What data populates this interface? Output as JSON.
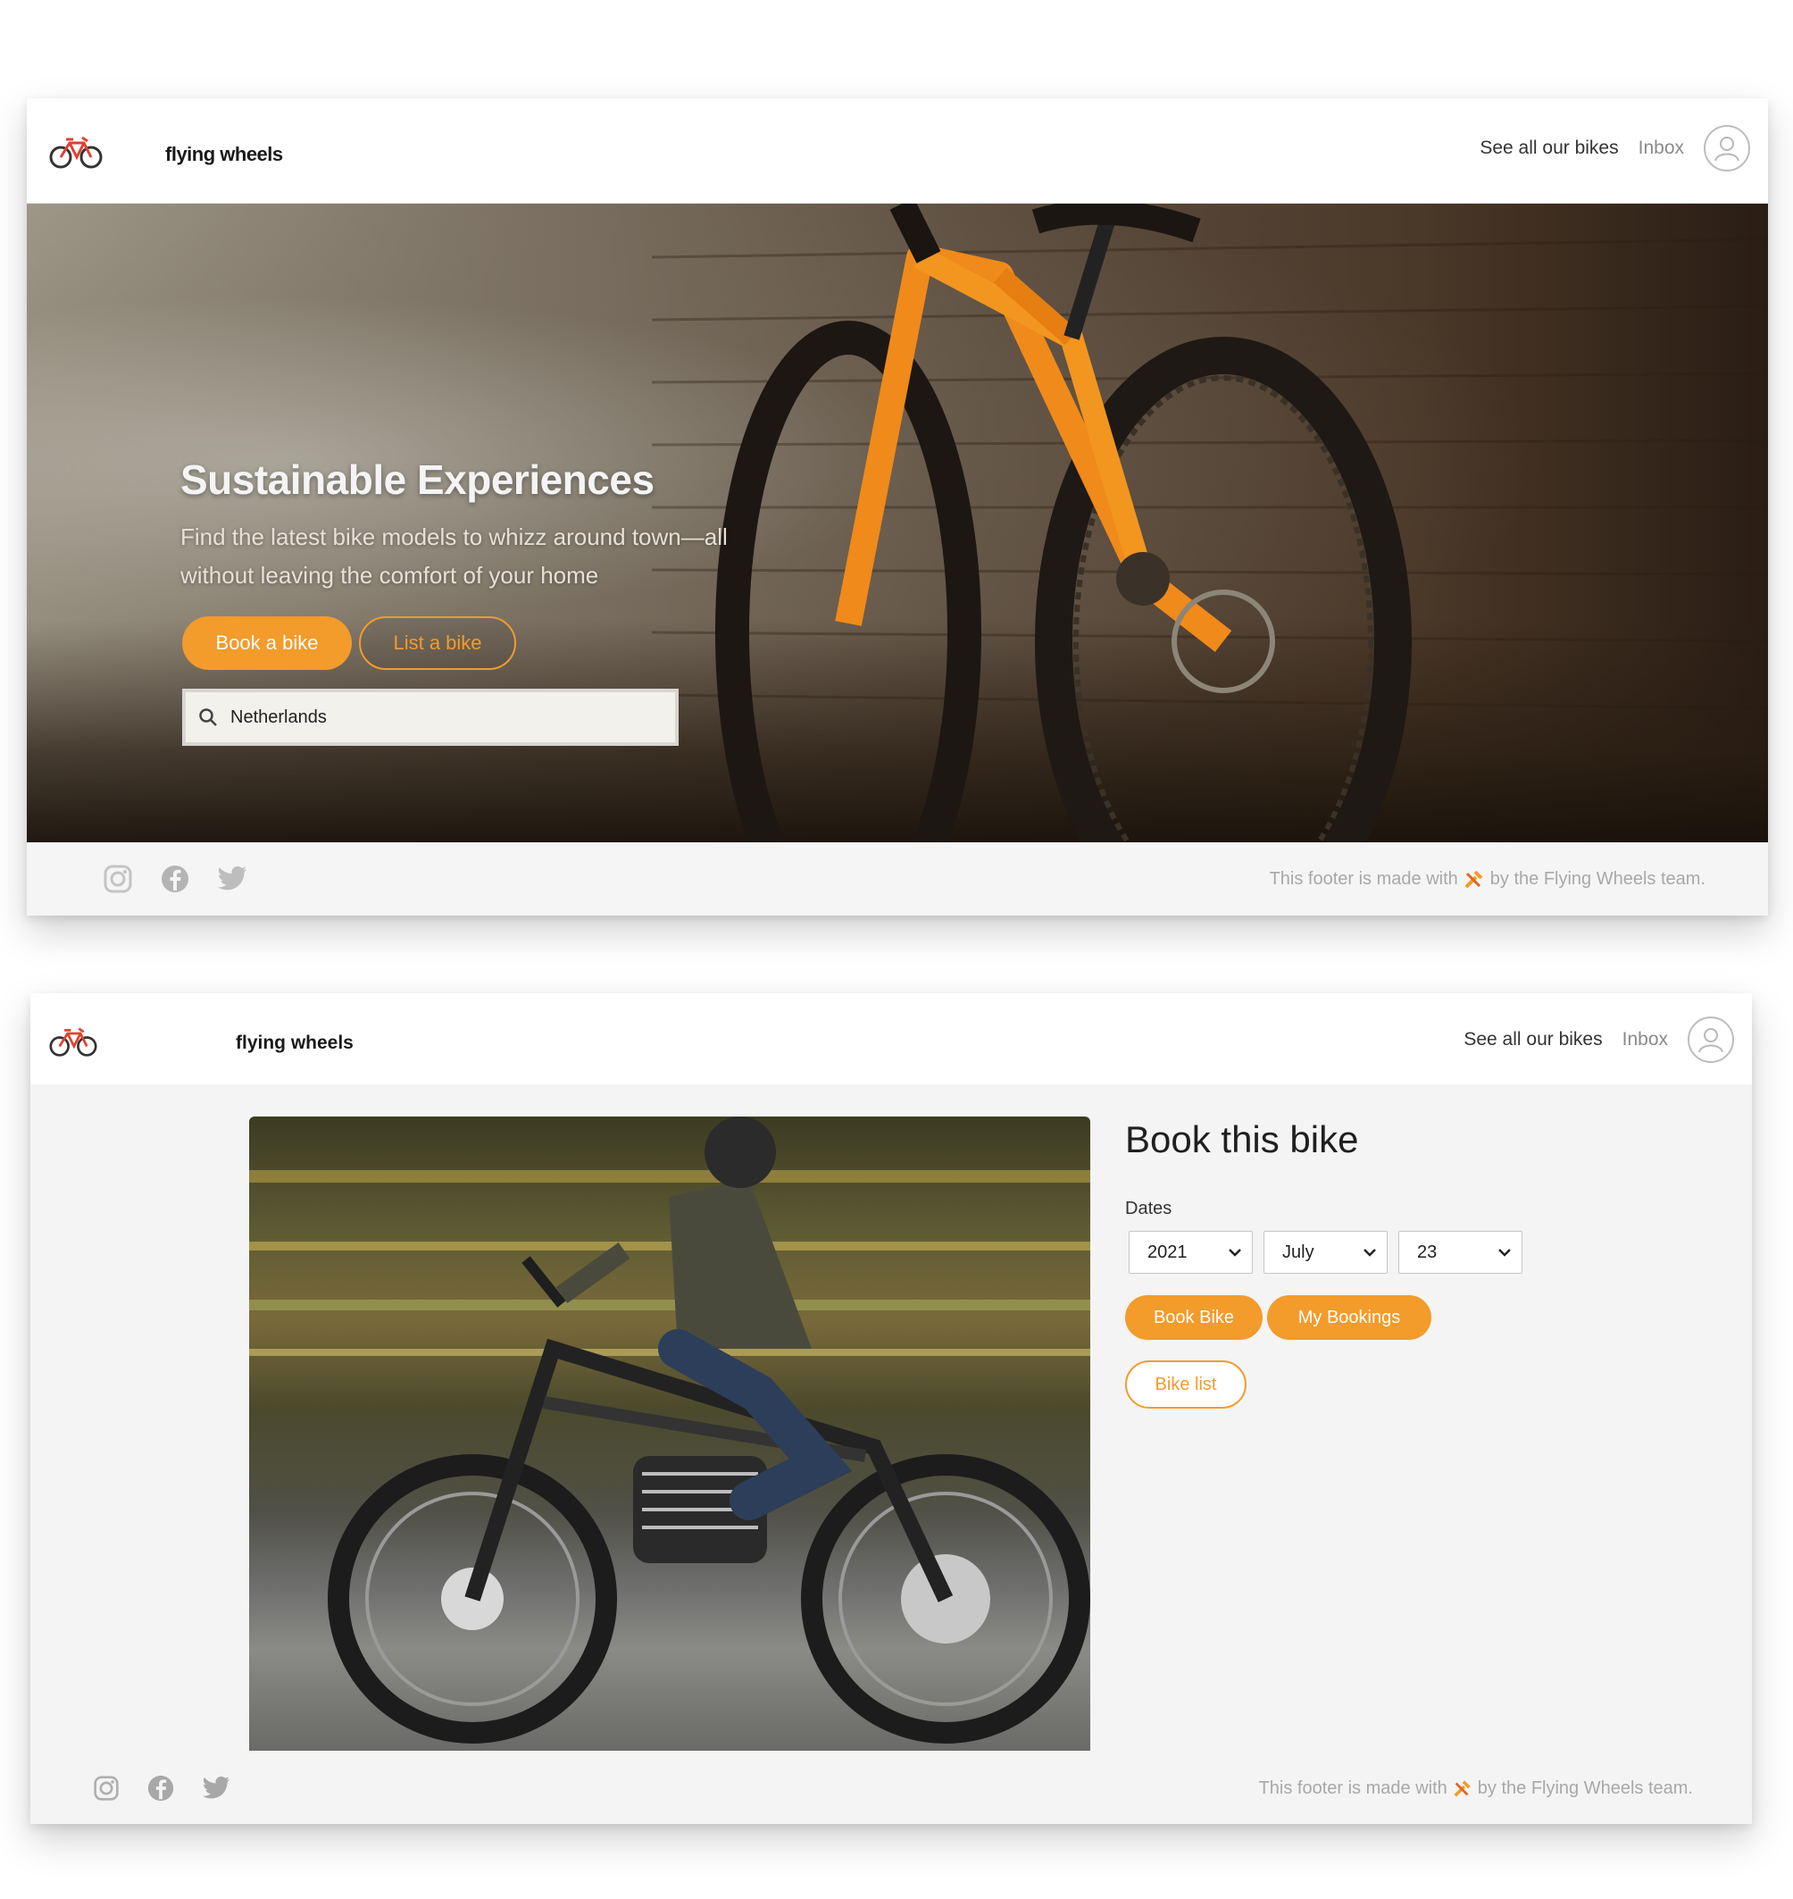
{
  "brand": {
    "name": "flying wheels"
  },
  "nav": {
    "see_all_bikes": "See all our bikes",
    "inbox": "Inbox"
  },
  "hero": {
    "title": "Sustainable Experiences",
    "subtitle": "Find the latest bike models to whizz around town—all without leaving the comfort of your home",
    "book_button": "Book a bike",
    "list_button": "List a bike",
    "search_value": "Netherlands"
  },
  "booking": {
    "title": "Book this bike",
    "dates_label": "Dates",
    "year": "2021",
    "month": "July",
    "day": "23",
    "book_button": "Book Bike",
    "bookings_button": "My Bookings",
    "list_button": "Bike list"
  },
  "footer": {
    "text_before": "This footer is made with",
    "text_after": "by the Flying Wheels team."
  },
  "icons": [
    "bike-logo-icon",
    "user-avatar-icon",
    "search-icon",
    "instagram-icon",
    "facebook-icon",
    "twitter-icon",
    "tools-icon",
    "chevron-down-icon"
  ],
  "colors": {
    "accent": "#f39b2b",
    "muted_text": "#a8a8a8",
    "page_bg": "#f4f4f4"
  }
}
